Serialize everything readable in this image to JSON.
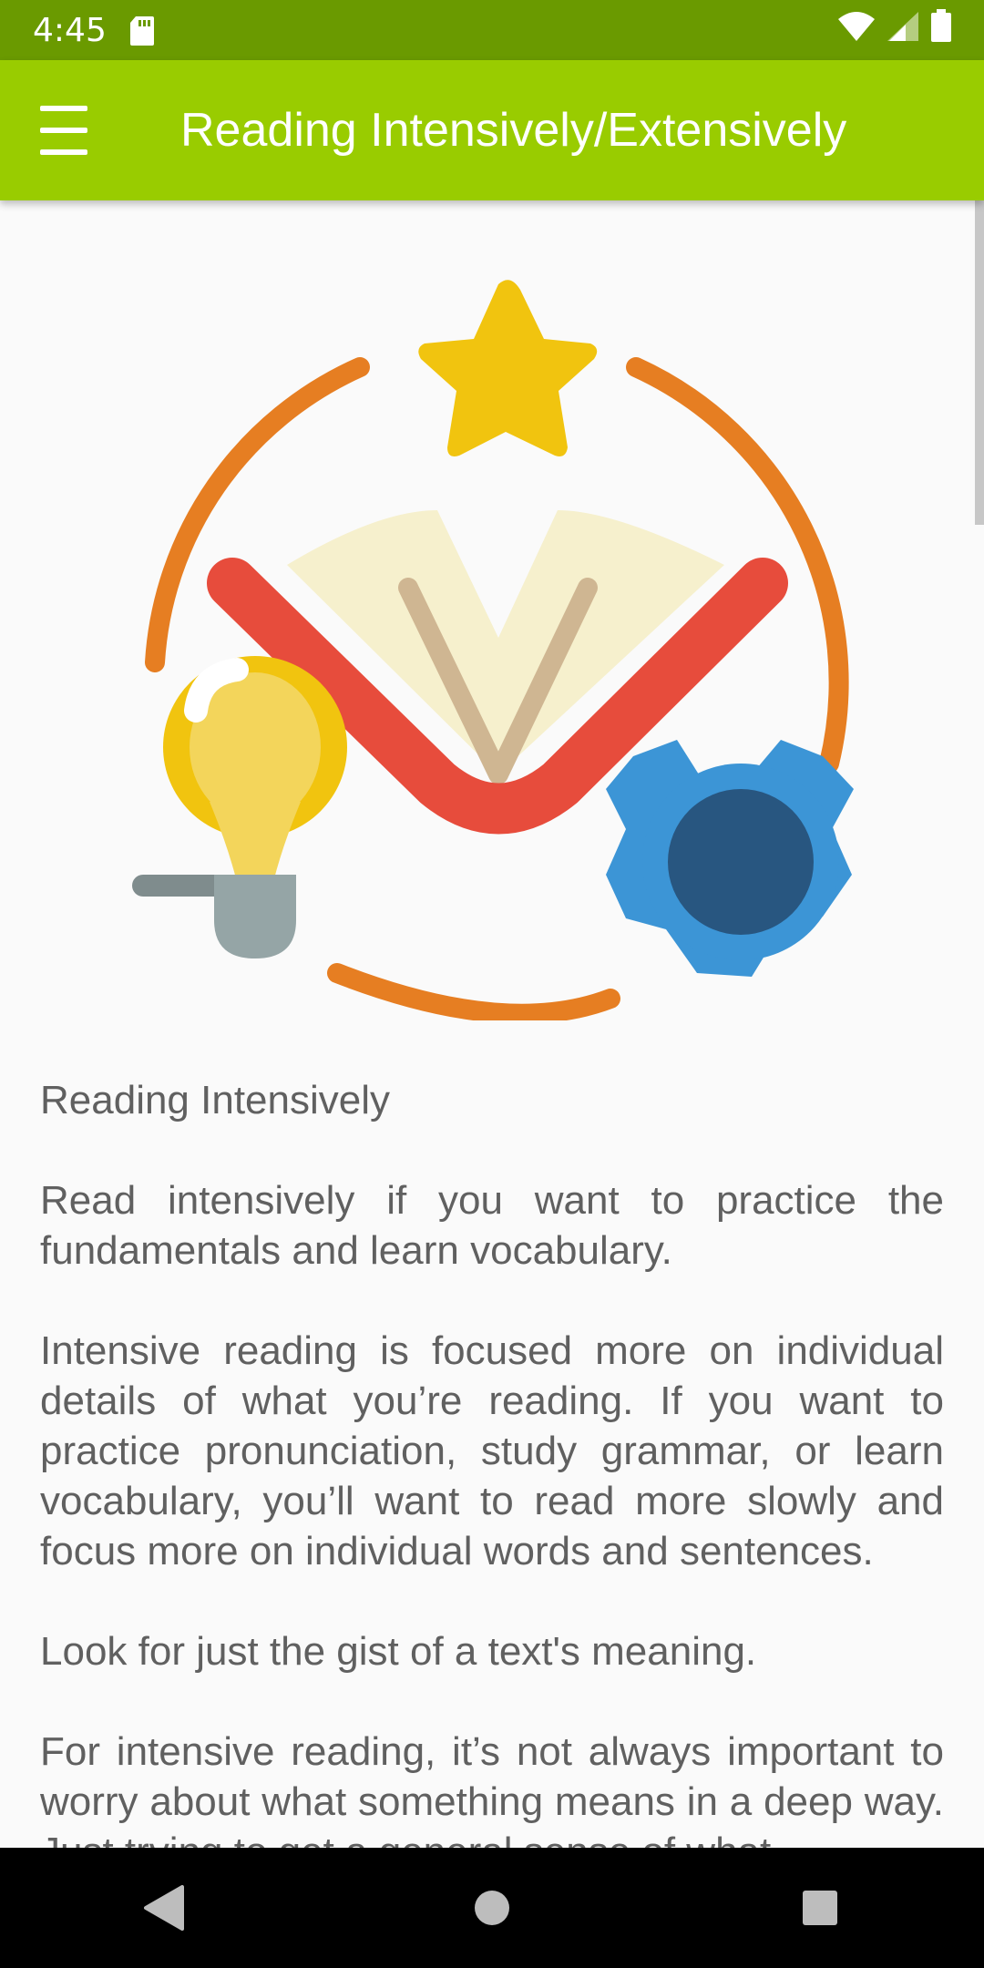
{
  "status_bar": {
    "time": "4:45",
    "icons": [
      "sd-card-icon",
      "wifi-icon",
      "signal-icon",
      "battery-icon"
    ]
  },
  "app_bar": {
    "title": "Reading Intensively/Extensively",
    "menu_icon": "hamburger-menu-icon",
    "background_color": "#99cc00"
  },
  "illustration": {
    "description_icons": [
      "star-icon",
      "open-book-icon",
      "light-bulb-icon",
      "gear-icon"
    ]
  },
  "article": {
    "heading": "Reading Intensively",
    "paragraphs": [
      " Read intensively if you want to practice the fundamentals and learn vocabulary.",
      " Intensive reading is focused more on individual details of what you’re reading. If you want to practice pronunciation, study grammar, or learn vocabulary, you’ll want to read more slowly and focus more on individual words and sentences.",
      " Look for just the gist of a text's meaning.",
      " For intensive reading, it’s not always important to worry about what something means in a deep way. Just trying to get a general sense of what"
    ]
  },
  "nav_bar": {
    "items": [
      "back-icon",
      "home-icon",
      "recents-icon"
    ]
  }
}
